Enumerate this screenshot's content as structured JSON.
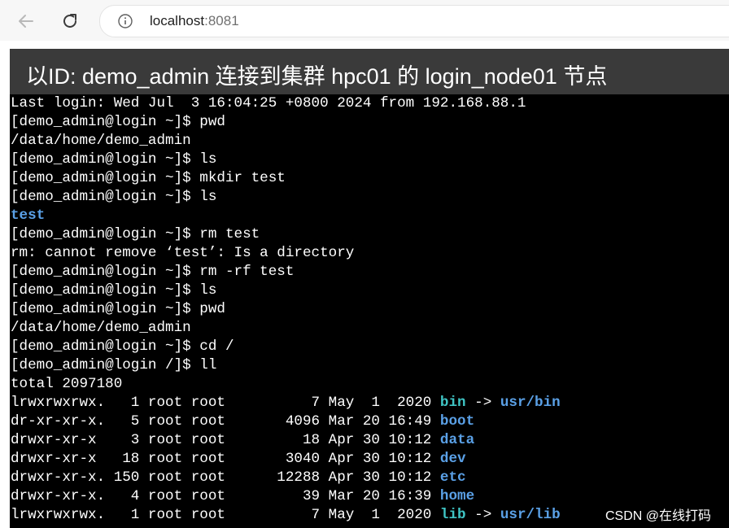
{
  "browser": {
    "url_host": "localhost",
    "url_port": ":8081"
  },
  "page": {
    "title": "以ID: demo_admin 连接到集群 hpc01 的 login_node01 节点"
  },
  "terminal": {
    "lines": [
      "Last login: Wed Jul  3 16:04:25 +0800 2024 from 192.168.88.1",
      "[demo_admin@login ~]$ pwd",
      "/data/home/demo_admin",
      "[demo_admin@login ~]$ ls",
      "[demo_admin@login ~]$ mkdir test",
      "[demo_admin@login ~]$ ls",
      "test",
      "[demo_admin@login ~]$ rm test",
      "rm: cannot remove ‘test’: Is a directory",
      "[demo_admin@login ~]$ rm -rf test",
      "[demo_admin@login ~]$ ls",
      "[demo_admin@login ~]$ pwd",
      "/data/home/demo_admin",
      "[demo_admin@login ~]$ cd /",
      "[demo_admin@login /]$ ll",
      "total 2097180"
    ],
    "listing": [
      {
        "prefix": "lrwxrwxrwx.   1 root root          7 May  1  2020 ",
        "name": "bin",
        "arrow": " -> ",
        "target": "usr/bin",
        "kind": "link"
      },
      {
        "prefix": "dr-xr-xr-x.   5 root root       4096 Mar 20 16:49 ",
        "name": "boot",
        "arrow": "",
        "target": "",
        "kind": "dir"
      },
      {
        "prefix": "drwxr-xr-x    3 root root         18 Apr 30 10:12 ",
        "name": "data",
        "arrow": "",
        "target": "",
        "kind": "dir"
      },
      {
        "prefix": "drwxr-xr-x   18 root root       3040 Apr 30 10:12 ",
        "name": "dev",
        "arrow": "",
        "target": "",
        "kind": "dir"
      },
      {
        "prefix": "drwxr-xr-x. 150 root root      12288 Apr 30 10:12 ",
        "name": "etc",
        "arrow": "",
        "target": "",
        "kind": "dir"
      },
      {
        "prefix": "drwxr-xr-x.   4 root root         39 Mar 20 16:39 ",
        "name": "home",
        "arrow": "",
        "target": "",
        "kind": "dir"
      },
      {
        "prefix": "lrwxrwxrwx.   1 root root          7 May  1  2020 ",
        "name": "lib",
        "arrow": " -> ",
        "target": "usr/lib",
        "kind": "link"
      }
    ]
  },
  "watermark": "CSDN @在线打码",
  "colors": {
    "terminal_bg": "#000000",
    "header_bg": "#3a3a3a",
    "dir": "#5aa0e6",
    "link": "#3fc4c4"
  },
  "icons": [
    "back-arrow-icon",
    "reload-icon",
    "info-icon"
  ]
}
